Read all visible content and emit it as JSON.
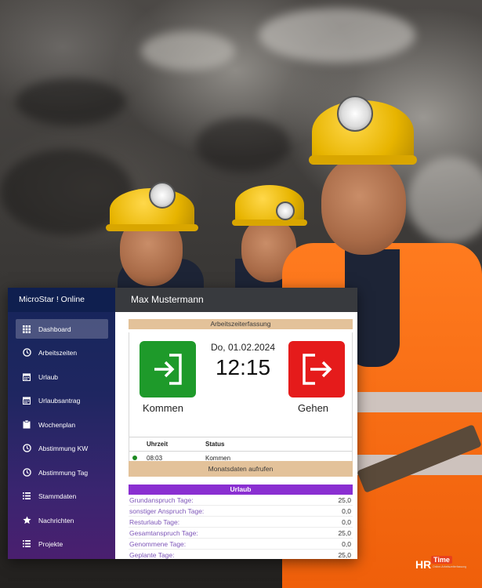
{
  "app": {
    "brand": "MicroStar ! Online",
    "user_name": "Max Mustermann"
  },
  "sidebar": {
    "items": [
      {
        "label": "Dashboard",
        "icon": "grid-icon",
        "active": true
      },
      {
        "label": "Arbeitszeiten",
        "icon": "clock-icon",
        "active": false
      },
      {
        "label": "Urlaub",
        "icon": "calendar-icon",
        "active": false
      },
      {
        "label": "Urlaubsantrag",
        "icon": "calendar-icon",
        "active": false
      },
      {
        "label": "Wochenplan",
        "icon": "clipboard-icon",
        "active": false
      },
      {
        "label": "Abstimmung KW",
        "icon": "clock-icon",
        "active": false
      },
      {
        "label": "Abstimmung Tag",
        "icon": "clock-icon",
        "active": false
      },
      {
        "label": "Stammdaten",
        "icon": "list-icon",
        "active": false
      },
      {
        "label": "Nachrichten",
        "icon": "star-icon",
        "active": false
      },
      {
        "label": "Projekte",
        "icon": "list-icon",
        "active": false
      }
    ]
  },
  "clocking": {
    "section_title": "Arbeitszeiterfassung",
    "date": "Do, 01.02.2024",
    "time": "12:15",
    "kommen_label": "Kommen",
    "gehen_label": "Gehen",
    "kommen_color": "#1e9a2a",
    "gehen_color": "#e51b1b",
    "table": {
      "headers": [
        "Uhrzeit",
        "Status"
      ],
      "rows": [
        {
          "time": "08:03",
          "status": "Kommen",
          "indicator_color": "#1d8a22"
        }
      ]
    }
  },
  "monthly_button": "Monatsdaten aufrufen",
  "urlaub": {
    "title": "Urlaub",
    "rows": [
      {
        "label": "Grundanspruch Tage:",
        "value": "25,0"
      },
      {
        "label": "sonstiger Anspruch Tage:",
        "value": "0,0"
      },
      {
        "label": "Resturlaub Tage:",
        "value": "0,0"
      },
      {
        "label": "Gesamtanspruch Tage:",
        "value": "25,0"
      },
      {
        "label": "Genommene Tage:",
        "value": "0,0"
      },
      {
        "label": "Geplante Tage:",
        "value": "25,0"
      }
    ]
  },
  "logo": {
    "hr": "HR",
    "time": "Time",
    "tagline": "Online-Arbeitszeiterfassung"
  }
}
